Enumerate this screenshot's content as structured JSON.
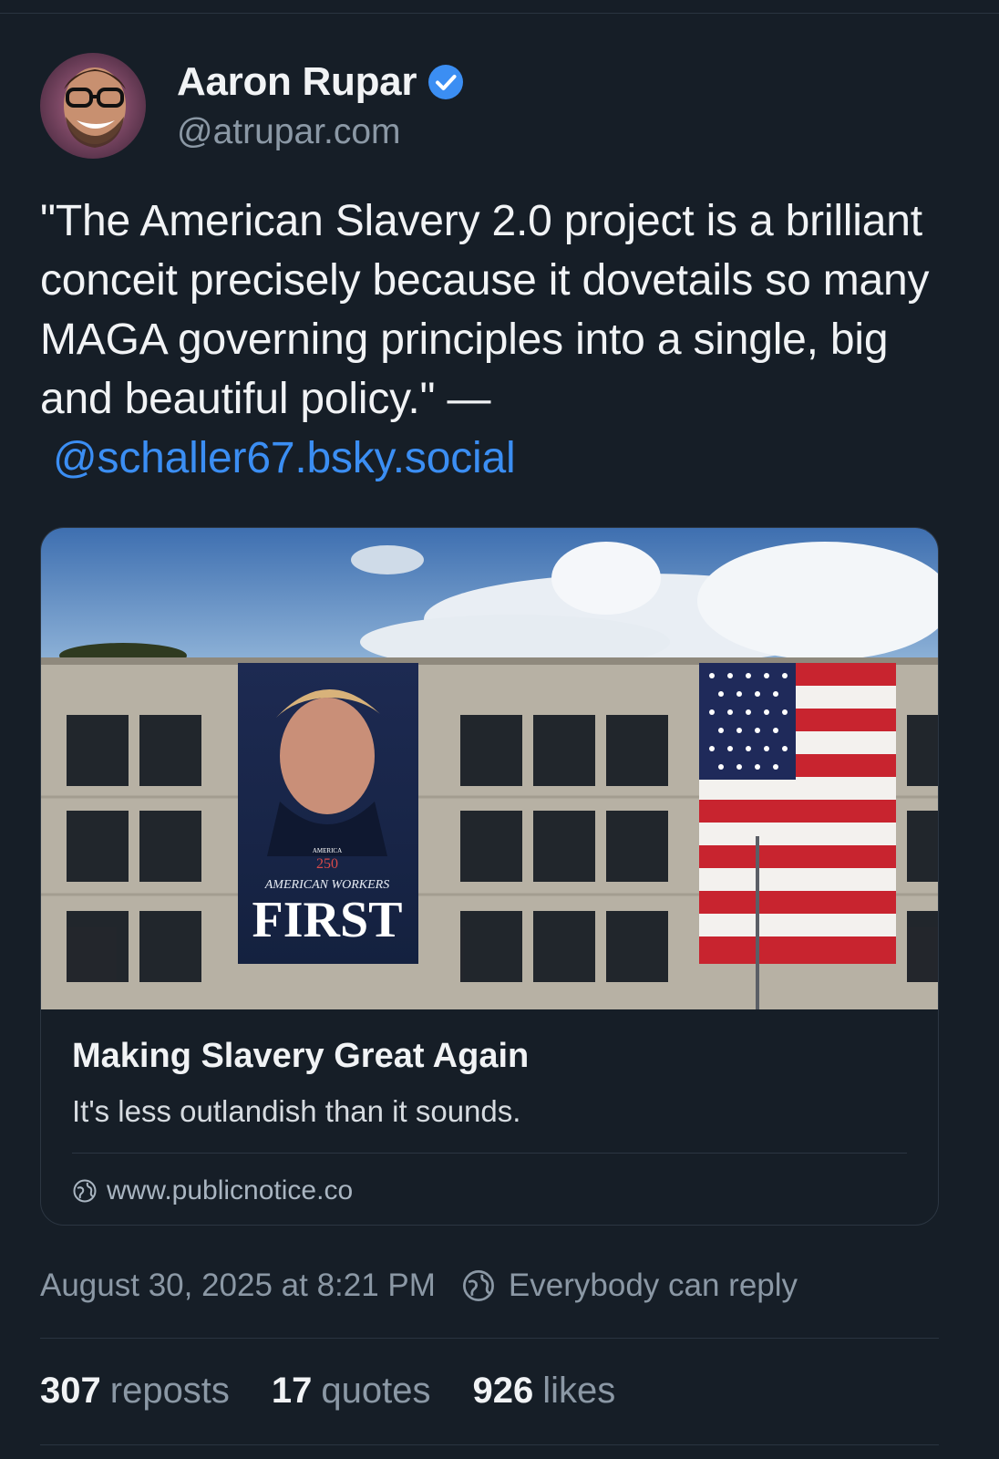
{
  "author": {
    "display_name": "Aaron Rupar",
    "handle": "@atrupar.com",
    "verified_icon": "verified-check-icon",
    "avatar": "avatar"
  },
  "post": {
    "text": "\"The American Slavery 2.0 project is a brilliant conceit precisely because it dovetails so many MAGA governing principles into a single, big and beautiful policy.\" —",
    "mention": "@schaller67.bsky.social"
  },
  "link_card": {
    "title": "Making Slavery Great Again",
    "description": "It's less outlandish than it sounds.",
    "domain": "www.publicnotice.co",
    "domain_icon": "globe-icon",
    "image_banner_text": {
      "small": "AMERICA",
      "number": "250",
      "line1": "AMERICAN WORKERS",
      "line2": "FIRST"
    }
  },
  "meta": {
    "timestamp": "August 30, 2025 at 8:21 PM",
    "reply_setting": "Everybody can reply",
    "reply_icon": "globe-icon"
  },
  "stats": {
    "reposts_count": "307",
    "reposts_label": "reposts",
    "quotes_count": "17",
    "quotes_label": "quotes",
    "likes_count": "926",
    "likes_label": "likes"
  },
  "colors": {
    "background": "#161e27",
    "accent": "#3b8ef3",
    "muted_text": "#8b98a5",
    "divider": "#2a3440"
  }
}
